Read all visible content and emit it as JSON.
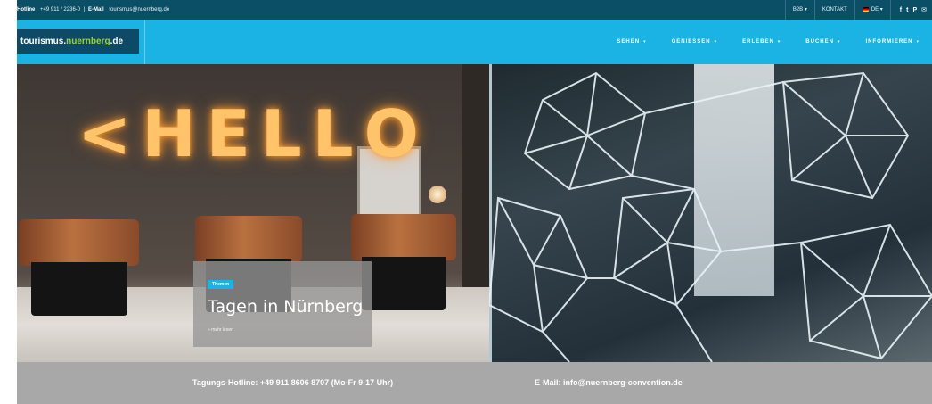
{
  "topbar": {
    "hotline_label": "Hotline",
    "hotline_value": "+49 911 / 2236-0",
    "email_label": "E-Mail",
    "email_value": "tourismus@nuernberg.de",
    "b2b": "B2B",
    "contact": "KONTAKT",
    "language": "DE",
    "social": [
      "f",
      "t",
      "P",
      "✉"
    ]
  },
  "logo": {
    "part1": "tourismus.",
    "part2": "nuernberg",
    "part3": ".de"
  },
  "nav": {
    "items": [
      {
        "label": "SEHEN"
      },
      {
        "label": "GENIESSEN"
      },
      {
        "label": "ERLEBEN"
      },
      {
        "label": "BUCHEN"
      },
      {
        "label": "INFORMIEREN"
      }
    ]
  },
  "hero": {
    "sign_letters": [
      "<",
      "H",
      "E",
      "L",
      "L",
      "O"
    ],
    "badge": "Themen",
    "title": "Tagen in Nürnberg",
    "more": "» mehr lesen"
  },
  "infobar": {
    "hotline": "Tagungs-Hotline: +49 911 8606 8707 (Mo-Fr 9-17 Uhr)",
    "email": "E-Mail: info@nuernberg-convention.de"
  },
  "colors": {
    "topbar_bg": "#0b4f66",
    "nav_bg": "#1bb3e3",
    "logo_green": "#9ad23a",
    "infobar_bg": "#a8a8a8"
  }
}
